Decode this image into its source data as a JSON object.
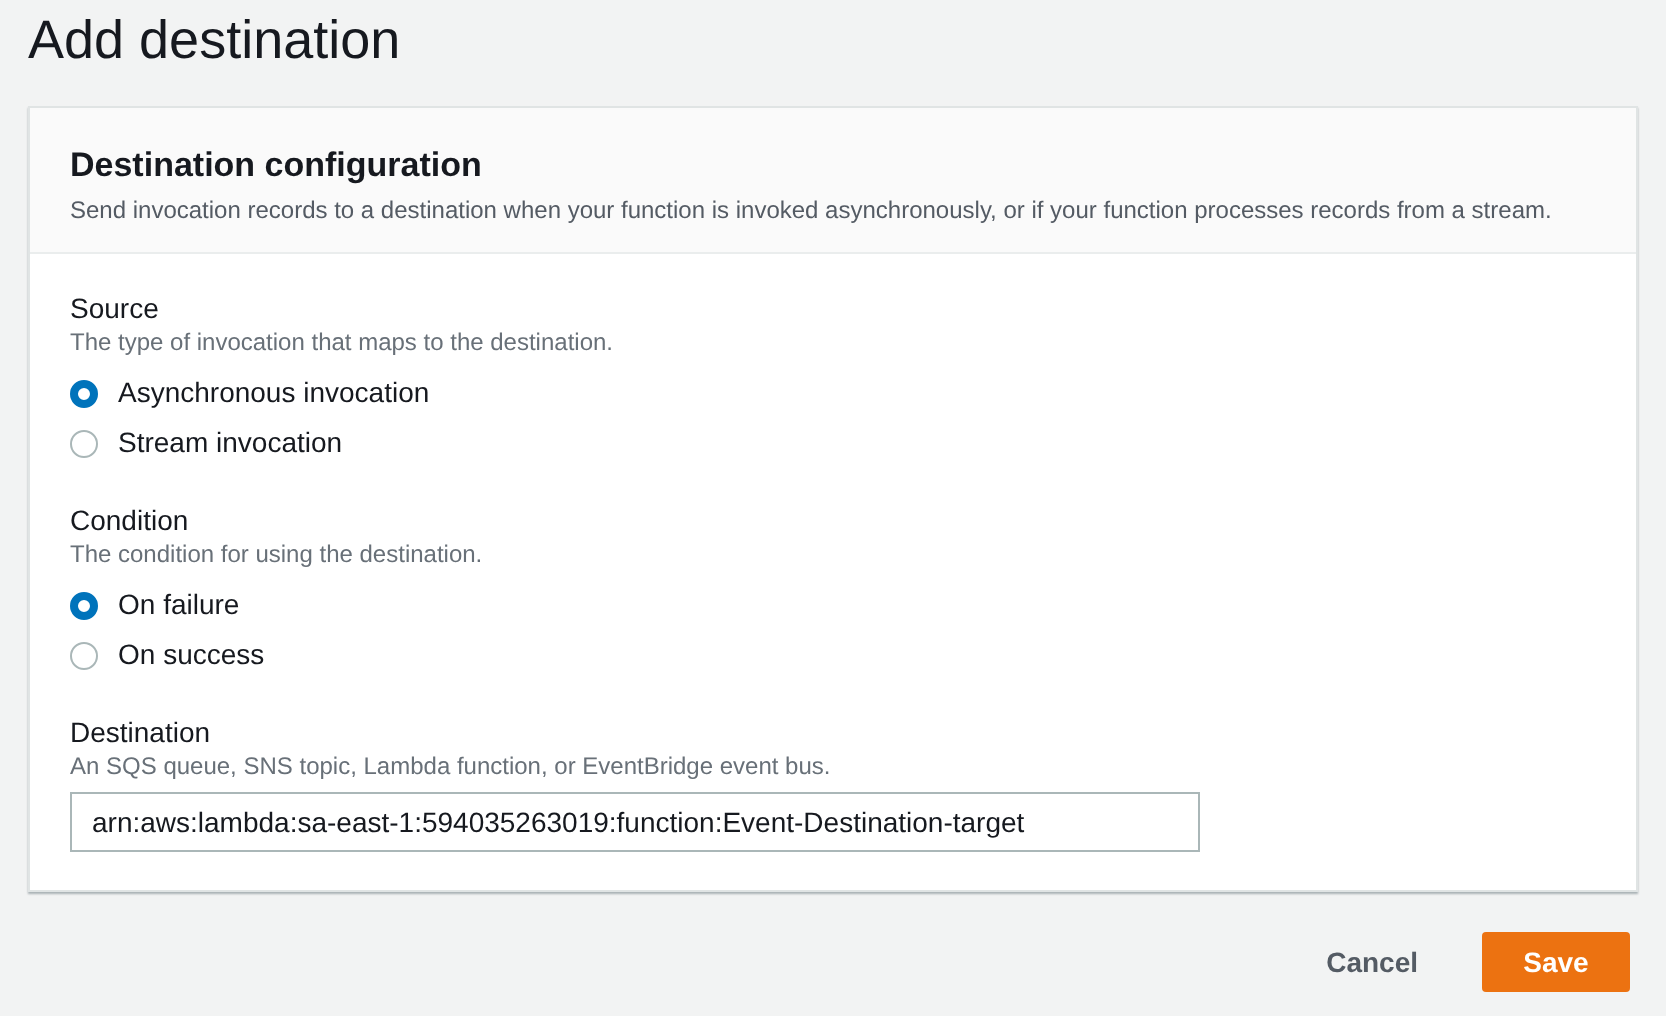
{
  "page_title": "Add destination",
  "panel": {
    "title": "Destination configuration",
    "description": "Send invocation records to a destination when your function is invoked asynchronously, or if your function processes records from a stream."
  },
  "fields": [
    {
      "kind": "radio",
      "label": "Source",
      "description": "The type of invocation that maps to the destination.",
      "options": [
        {
          "label": "Asynchronous invocation",
          "selected": true
        },
        {
          "label": "Stream invocation",
          "selected": false
        }
      ]
    },
    {
      "kind": "radio",
      "label": "Condition",
      "description": "The condition for using the destination.",
      "options": [
        {
          "label": "On failure",
          "selected": true
        },
        {
          "label": "On success",
          "selected": false
        }
      ]
    },
    {
      "kind": "input",
      "label": "Destination",
      "description": "An SQS queue, SNS topic, Lambda function, or EventBridge event bus.",
      "value": "arn:aws:lambda:sa-east-1:594035263019:function:Event-Destination-target"
    }
  ],
  "buttons": [
    {
      "kind": "link",
      "label": "Cancel"
    },
    {
      "kind": "primary",
      "label": "Save"
    }
  ]
}
